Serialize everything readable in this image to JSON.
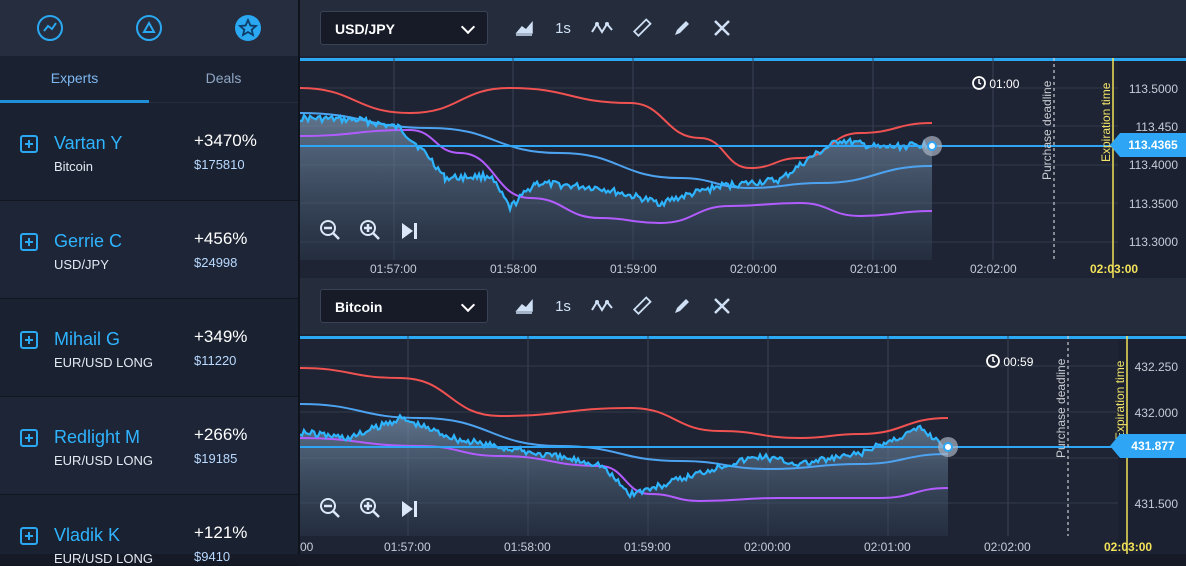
{
  "sidebar": {
    "icons": [
      "experts-icon",
      "deals-icon",
      "star-icon"
    ],
    "tabs": [
      {
        "label": "Experts"
      },
      {
        "label": "Deals"
      }
    ],
    "experts": [
      {
        "name": "Vartan Y",
        "asset": "Bitcoin",
        "pct": "+3470%",
        "amount": "$175810"
      },
      {
        "name": "Gerrie C",
        "asset": "USD/JPY",
        "pct": "+456%",
        "amount": "$24998"
      },
      {
        "name": "Mihail G",
        "asset": "EUR/USD LONG",
        "pct": "+349%",
        "amount": "$11220"
      },
      {
        "name": "Redlight M",
        "asset": "EUR/USD LONG",
        "pct": "+266%",
        "amount": "$19185"
      },
      {
        "name": "Vladik K",
        "asset": "EUR/USD LONG",
        "pct": "+121%",
        "amount": "$9410"
      }
    ]
  },
  "charts": [
    {
      "asset": "USD/JPY",
      "interval": "1s",
      "timer": "01:00",
      "purchase_deadline": "Purchase deadline",
      "expiration_time": "Expiration time",
      "current_price": "113.4365",
      "yticks": [
        "113.5000",
        "113.450",
        "113.4000",
        "113.3500",
        "113.3000"
      ],
      "xticks": [
        "01:57:00",
        "01:58:00",
        "01:59:00",
        "02:00:00",
        "02:01:00",
        "02:02:00",
        "02:03:00"
      ]
    },
    {
      "asset": "Bitcoin",
      "interval": "1s",
      "timer": "00:59",
      "purchase_deadline": "Purchase deadline",
      "expiration_time": "Expiration time",
      "current_price": "431.877",
      "yticks": [
        "432.250",
        "432.000",
        "431.500"
      ],
      "xticks": [
        "00",
        "01:57:00",
        "01:58:00",
        "01:59:00",
        "02:00:00",
        "02:01:00",
        "02:02:00",
        "02:03:00"
      ]
    }
  ],
  "colors": {
    "accent": "#2fa6f5",
    "red_line": "#f05252",
    "purple_line": "#b25cff",
    "blue_line": "#4da3f0",
    "expiration": "#f3e25a"
  }
}
